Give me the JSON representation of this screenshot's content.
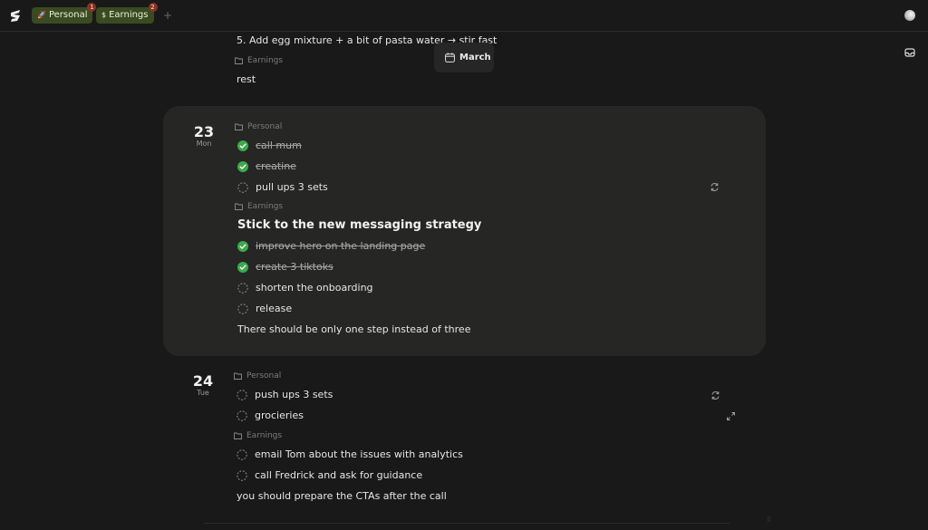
{
  "workspaces": [
    {
      "label": "Personal",
      "icon": "rocket-icon",
      "badge": "1"
    },
    {
      "label": "Earnings",
      "icon": "dollar-icon",
      "badge": "2"
    }
  ],
  "colors": {
    "background": "#191919",
    "card": "#262625",
    "tab_bg": "#3a4a21",
    "badge_bg": "#8a3324",
    "check_done": "#3aaa4a"
  },
  "month_popup": {
    "label": "March"
  },
  "top_section": {
    "step": "5.  Add egg mixture + a bit of pasta water → stir fast",
    "tag": "Earnings",
    "note": "rest"
  },
  "day23": {
    "num": "23",
    "weekday": "Mon",
    "personal_tag": "Personal",
    "personal_tasks": [
      {
        "label": "call mum",
        "done": true
      },
      {
        "label": "creatine",
        "done": true
      },
      {
        "label": "pull ups 3 sets",
        "done": false
      }
    ],
    "earnings_tag": "Earnings",
    "goal": "Stick to the new messaging strategy",
    "earnings_tasks": [
      {
        "label": "improve hero on the landing page",
        "done": true
      },
      {
        "label": "create 3 tiktoks",
        "done": true
      },
      {
        "label": "shorten the onboarding",
        "done": false
      },
      {
        "label": "release",
        "done": false
      }
    ],
    "note": "There should be only one step instead of three"
  },
  "day24": {
    "num": "24",
    "weekday": "Tue",
    "personal_tag": "Personal",
    "personal_tasks": [
      {
        "label": "push ups 3 sets",
        "done": false
      },
      {
        "label": "grocieries",
        "done": false
      }
    ],
    "earnings_tag": "Earnings",
    "earnings_tasks": [
      {
        "label": "email Tom about the issues with analytics",
        "done": false
      },
      {
        "label": "call Fredrick and ask for guidance",
        "done": false
      }
    ],
    "note": "you should prepare the CTAs after the call"
  }
}
